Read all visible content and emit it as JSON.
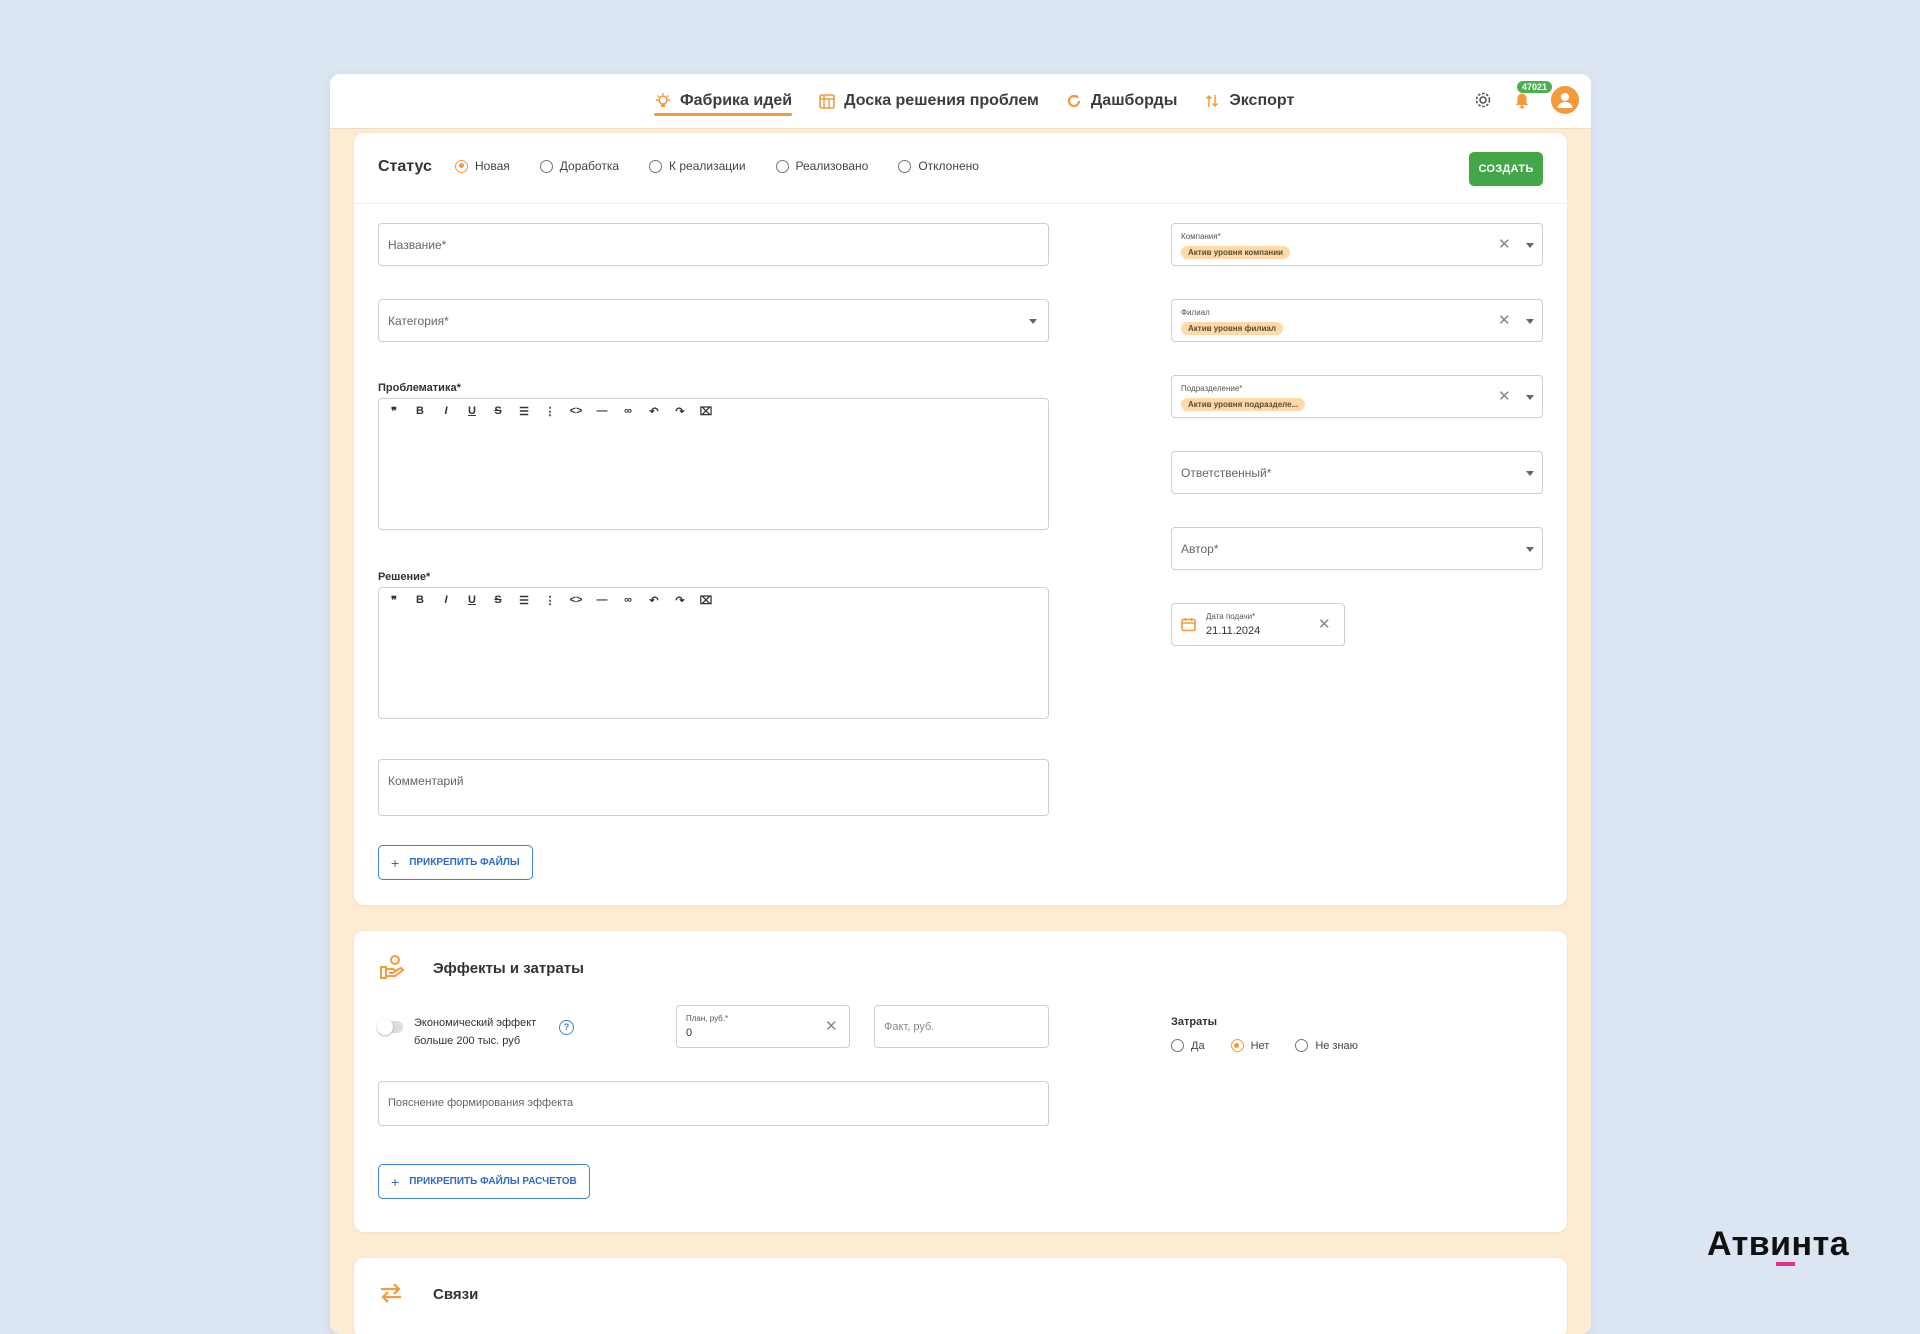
{
  "nav": {
    "items": [
      {
        "label": "Фабрика идей",
        "icon": "lightbulb-icon",
        "active": true
      },
      {
        "label": "Доска решения проблем",
        "icon": "board-icon",
        "active": false
      },
      {
        "label": "Дашборды",
        "icon": "refresh-icon",
        "active": false
      },
      {
        "label": "Экспорт",
        "icon": "export-icon",
        "active": false
      }
    ],
    "notification_count": "47021"
  },
  "status": {
    "title": "Статус",
    "options": [
      "Новая",
      "Доработка",
      "К реализации",
      "Реализовано",
      "Отклонено"
    ],
    "selected": "Новая",
    "create_label": "СОЗДАТЬ"
  },
  "form": {
    "name_placeholder": "Название*",
    "category_placeholder": "Категория*",
    "problem_label": "Проблематика*",
    "solution_label": "Решение*",
    "comment_placeholder": "Комментарий",
    "attach_label": "ПРИКРЕПИТЬ ФАЙЛЫ",
    "toolbar": [
      "❞",
      "B",
      "I",
      "U",
      "S",
      "☰",
      "⋮",
      "<>",
      "—",
      "∞",
      "↶",
      "↷",
      "⌧"
    ]
  },
  "right": {
    "company_label": "Компания*",
    "company_value": "Актив уровня компании",
    "branch_label": "Филиал",
    "branch_value": "Актив уровня филиал",
    "division_label": "Подразделение*",
    "division_value": "Актив уровня подразделе...",
    "responsible_placeholder": "Ответственный*",
    "author_placeholder": "Автор*",
    "date_label": "Дата подачи*",
    "date_value": "21.11.2024"
  },
  "effects": {
    "title": "Эффекты и затраты",
    "toggle_label_1": "Экономический эффект",
    "toggle_label_2": "больше 200 тыс. руб",
    "plan_label": "План, руб.*",
    "plan_value": "0",
    "fact_placeholder": "Факт, руб.",
    "costs_label": "Затраты",
    "costs_options": [
      "Да",
      "Нет",
      "Не знаю"
    ],
    "costs_selected": "Нет",
    "explanation_placeholder": "Пояснение формирования эффекта",
    "attach_calc_label": "ПРИКРЕПИТЬ ФАЙЛЫ РАСЧЕТОВ"
  },
  "links": {
    "title": "Связи"
  },
  "brand": {
    "name": "Атвинта",
    "accent_color": "#e1318c"
  },
  "colors": {
    "accent": "#f39a3c",
    "success": "#43a74a",
    "link": "#3b82d6",
    "background": "#dce6f3"
  }
}
